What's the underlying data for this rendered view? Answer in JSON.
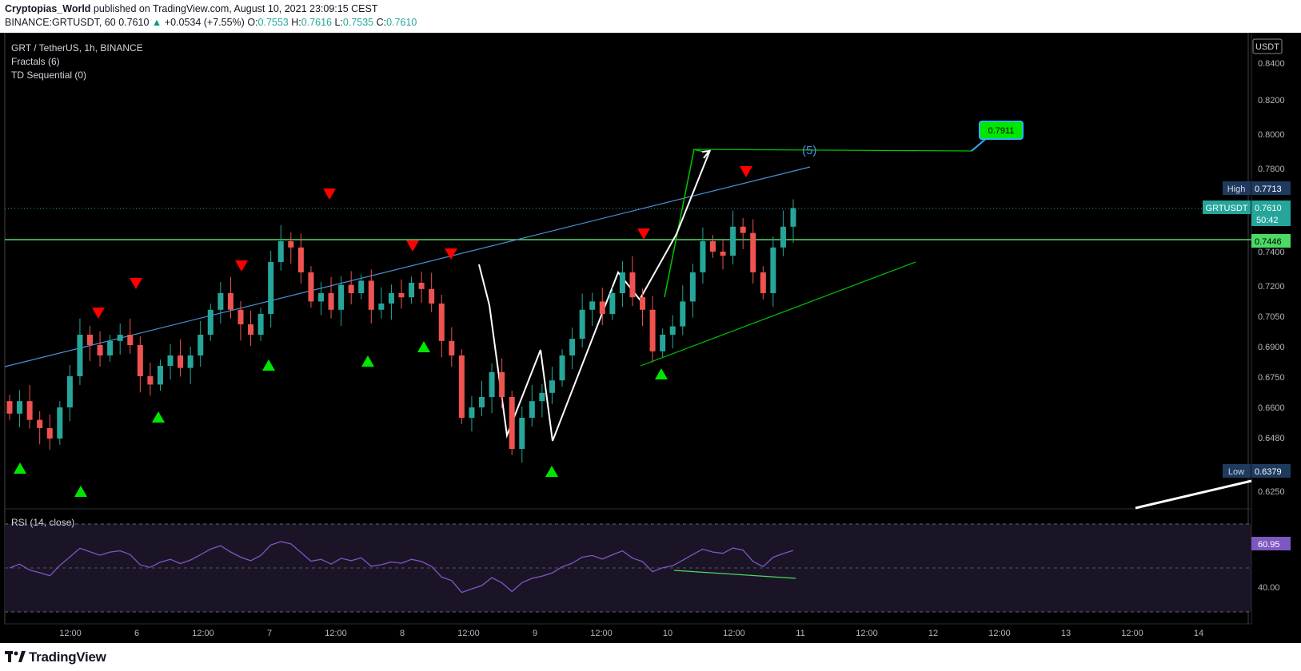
{
  "header": {
    "author": "Cryptopias_World",
    "published_text": "published on TradingView.com, August 10, 2021 23:09:15 CEST",
    "symbol_line": "BINANCE:GRTUSDT, 60",
    "last": "0.7610",
    "change": "+0.0534 (+7.55%)",
    "o_label": "O:",
    "o": "0.7553",
    "h_label": "H:",
    "h": "0.7616",
    "l_label": "L:",
    "l": "0.7535",
    "c_label": "C:",
    "c": "0.7610"
  },
  "legend": {
    "title": "GRT / TetherUS, 1h, BINANCE",
    "indicator1": "Fractals (6)",
    "indicator2": "TD Sequential (0)",
    "rsi": "RSI (14, close)"
  },
  "price_axis": {
    "currency": "USDT",
    "ticks": [
      "0.8400",
      "0.8200",
      "0.8000",
      "0.7800",
      "0.7400",
      "0.7200",
      "0.7050",
      "0.6900",
      "0.6750",
      "0.6600",
      "0.6480",
      "0.6250"
    ],
    "high_label": "High",
    "high_value": "0.7713",
    "low_label": "Low",
    "low_value": "0.6379",
    "symbol_label": "GRTUSDT",
    "symbol_value": "0.7610",
    "countdown": "50:42",
    "level_value": "0.7446"
  },
  "rsi_axis": {
    "value": "60.95",
    "tick": "40.00"
  },
  "time_axis": [
    "12:00",
    "6",
    "12:00",
    "7",
    "12:00",
    "8",
    "12:00",
    "9",
    "12:00",
    "10",
    "12:00",
    "11",
    "12:00",
    "12",
    "12:00",
    "13",
    "12:00",
    "14"
  ],
  "annotations": {
    "target_label": "0.7911",
    "wave_label": "(5)"
  },
  "footer": {
    "brand": "TradingView"
  },
  "colors": {
    "bull": "#26a69a",
    "bear": "#ef5350",
    "fractal_up": "#00e600",
    "fractal_down": "#ff0000",
    "trend_blue": "#4a90d9",
    "level_green": "#4cd964",
    "rsi_line": "#7e57c2",
    "rsi_band": "#1b1427"
  },
  "chart_data": {
    "type": "candlestick",
    "interval": "1h",
    "x_labels": [
      "12:00",
      "6",
      "12:00",
      "7",
      "12:00",
      "8",
      "12:00",
      "9",
      "12:00",
      "10",
      "12:00",
      "11",
      "12:00",
      "12",
      "12:00",
      "13",
      "12:00",
      "14"
    ],
    "ylim": [
      0.618,
      0.845
    ],
    "high": 0.7713,
    "low": 0.6379,
    "last": 0.761,
    "horizontal_level": 0.7446,
    "target": 0.7911,
    "candle_closes_approx": [
      0.662,
      0.668,
      0.659,
      0.655,
      0.65,
      0.665,
      0.68,
      0.7,
      0.695,
      0.69,
      0.697,
      0.7,
      0.695,
      0.68,
      0.676,
      0.685,
      0.69,
      0.684,
      0.69,
      0.7,
      0.712,
      0.72,
      0.712,
      0.705,
      0.7,
      0.71,
      0.735,
      0.745,
      0.742,
      0.73,
      0.716,
      0.72,
      0.712,
      0.724,
      0.72,
      0.726,
      0.712,
      0.715,
      0.72,
      0.718,
      0.725,
      0.722,
      0.715,
      0.697,
      0.69,
      0.66,
      0.665,
      0.67,
      0.682,
      0.67,
      0.645,
      0.66,
      0.668,
      0.672,
      0.678,
      0.69,
      0.698,
      0.712,
      0.716,
      0.71,
      0.72,
      0.73,
      0.718,
      0.712,
      0.692,
      0.7,
      0.704,
      0.716,
      0.73,
      0.745,
      0.74,
      0.738,
      0.752,
      0.749,
      0.73,
      0.72,
      0.742,
      0.752,
      0.761
    ],
    "fractals_up_at": [
      0.7277,
      0.7266,
      0.7186,
      0.732,
      0.7295,
      0.756,
      0.736,
      0.734,
      0.734,
      0.756,
      0.7805
    ],
    "fractals_down_at": [
      0.6568,
      0.6532,
      0.6678,
      0.6806,
      0.682,
      0.6848,
      0.6752,
      0.6492
    ],
    "rsi": {
      "period": 14,
      "last": 60.95,
      "levels": [
        70,
        50,
        30
      ]
    }
  }
}
